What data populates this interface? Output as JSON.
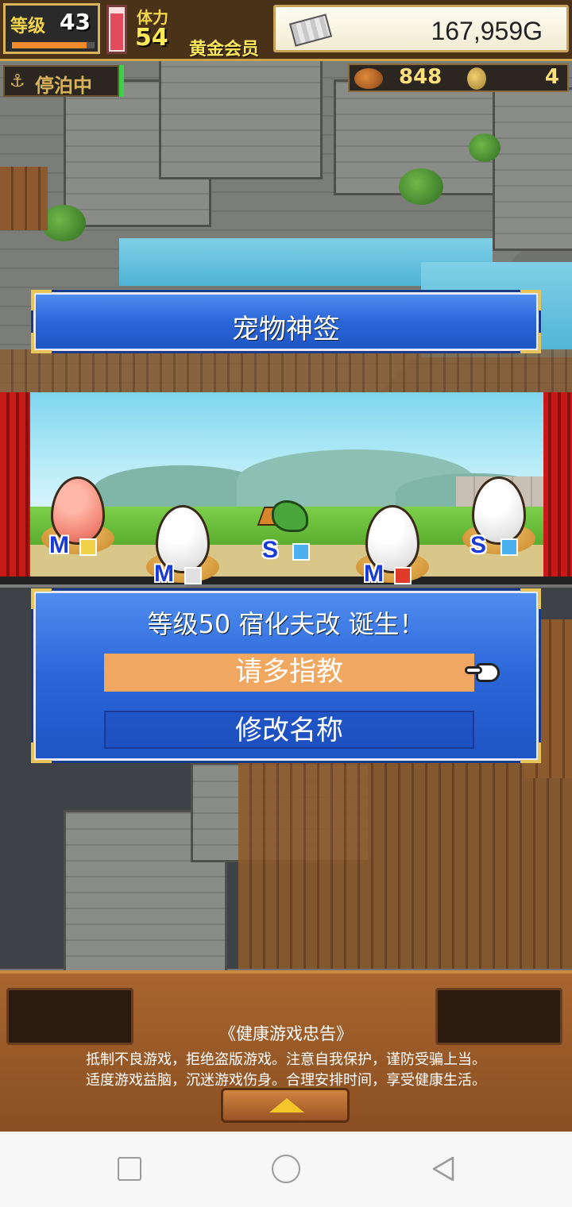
{
  "hud": {
    "level_label": "等级",
    "level_value": "43",
    "level_progress": 0.9,
    "stamina_label": "体力",
    "stamina_value": "54",
    "stamina_fill": 0.9,
    "membership": "黄金会员",
    "money": "167,959G",
    "money_icon": "silver-bar-icon",
    "dock_status": "停泊中",
    "dock_icon": "anchor-icon",
    "food_icon": "meat-icon",
    "food_value": "848",
    "medal_icon": "coin-icon",
    "medal_value": "4"
  },
  "dialog": {
    "title": "宠物神签",
    "result_message": "等级50 宿化夫改 诞生！",
    "primary_button": "请多指教",
    "secondary_button": "修改名称",
    "pointer_icon": "hand-pointer-icon"
  },
  "eggs": [
    {
      "size": "M",
      "color": "pink",
      "element_color": "#f0d24a"
    },
    {
      "size": "M",
      "color": "white",
      "element_color": "#e0e0e0"
    },
    {
      "size": "S",
      "color": "dragon",
      "element_color": "#4ab0f0"
    },
    {
      "size": "M",
      "color": "white",
      "element_color": "#e03a2a"
    },
    {
      "size": "S",
      "color": "white",
      "element_color": "#4ab0f0"
    }
  ],
  "footer": {
    "notice_title": "《健康游戏忠告》",
    "notice_line1": "抵制不良游戏，拒绝盗版游戏。注意自我保护，谨防受骗上当。",
    "notice_line2": "适度游戏益脑，沉迷游戏伤身。合理安排时间，享受健康生活。",
    "expand_icon": "triangle-up-icon"
  },
  "system_nav": {
    "recents_icon": "square-icon",
    "home_icon": "circle-icon",
    "back_icon": "triangle-back-icon"
  }
}
